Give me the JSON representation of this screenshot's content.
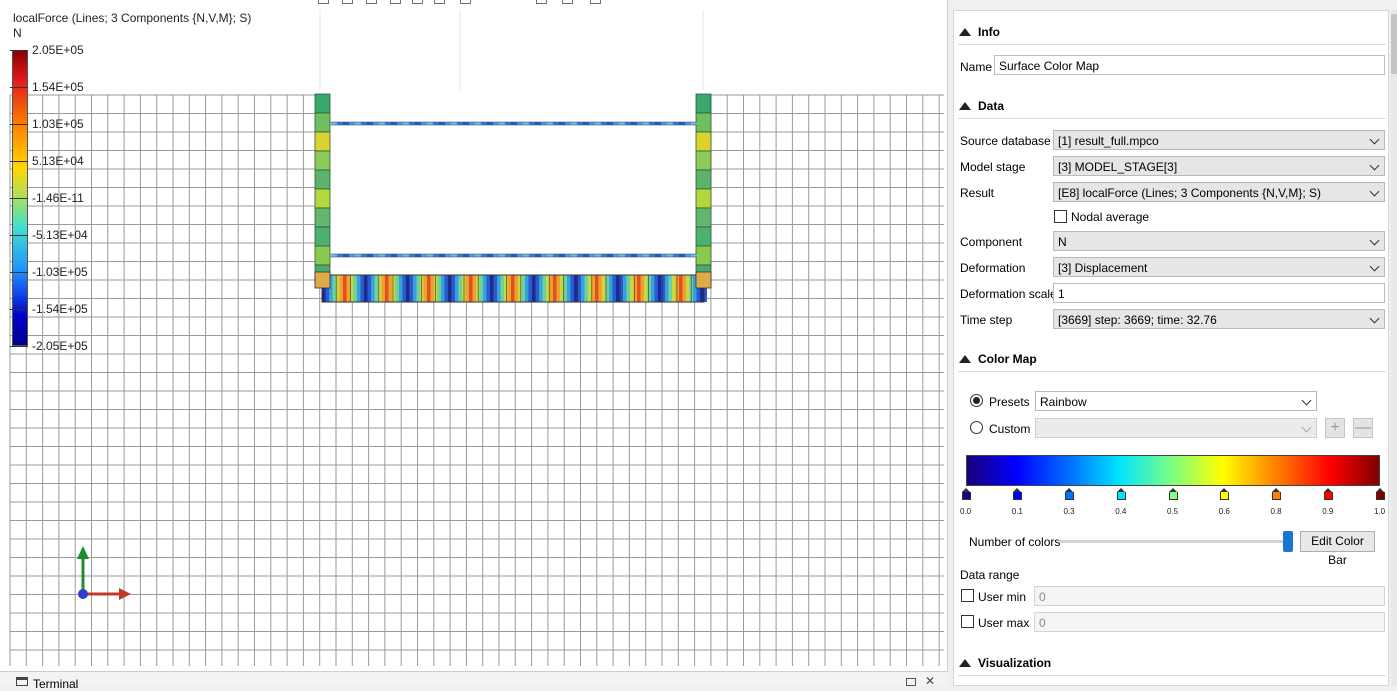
{
  "viewport": {
    "result_title": "localForce (Lines; 3 Components {N,V,M}; S)",
    "component_label": "N",
    "legend_ticks": [
      "2.05E+05",
      "1.54E+05",
      "1.03E+05",
      "5.13E+04",
      "-1.46E-11",
      "-5.13E+04",
      "-1.03E+05",
      "-1.54E+05",
      "-2.05E+05"
    ],
    "axis_colors": {
      "x": "#c0392b",
      "y": "#1e8c2e",
      "z": "#2a3fcf"
    },
    "grid_color": "#9a9a9a"
  },
  "terminal": {
    "label": "Terminal",
    "close_icon": "✕"
  },
  "panel": {
    "info": {
      "title": "Info",
      "name_label": "Name",
      "name_value": "Surface Color Map"
    },
    "data": {
      "title": "Data",
      "source_database_label": "Source database",
      "source_database_value": "[1] result_full.mpco",
      "model_stage_label": "Model stage",
      "model_stage_value": "[3] MODEL_STAGE[3]",
      "result_label": "Result",
      "result_value": "[E8] localForce (Lines; 3 Components {N,V,M}; S)",
      "nodal_average_label": "Nodal average",
      "nodal_average_checked": false,
      "component_label": "Component",
      "component_value": "N",
      "deformation_label": "Deformation",
      "deformation_value": "[3] Displacement",
      "deformation_scale_label": "Deformation scale",
      "deformation_scale_value": "1",
      "time_step_label": "Time step",
      "time_step_value": "[3669] step: 3669; time: 32.76"
    },
    "color_map": {
      "title": "Color Map",
      "presets_label": "Presets",
      "presets_value": "Rainbow",
      "presets_selected": true,
      "custom_label": "Custom",
      "custom_value": "",
      "add_icon": "+",
      "remove_icon": "—",
      "stops": [
        {
          "label": "0.0",
          "color": "#1a007a"
        },
        {
          "label": "0.1",
          "color": "#0000ff"
        },
        {
          "label": "0.3",
          "color": "#0070ff"
        },
        {
          "label": "0.4",
          "color": "#00e5ff"
        },
        {
          "label": "0.5",
          "color": "#7fff7f"
        },
        {
          "label": "0.6",
          "color": "#ffff00"
        },
        {
          "label": "0.8",
          "color": "#ff8000"
        },
        {
          "label": "0.9",
          "color": "#ff0000"
        },
        {
          "label": "1.0",
          "color": "#800000"
        }
      ],
      "number_of_colors_label": "Number of colors",
      "number_of_colors_level": 0.97,
      "edit_color_bar_label": "Edit Color Bar",
      "data_range_label": "Data range",
      "user_min_label": "User min",
      "user_min_value": "0",
      "user_max_label": "User max",
      "user_max_value": "0"
    },
    "visualization": {
      "title": "Visualization"
    }
  }
}
